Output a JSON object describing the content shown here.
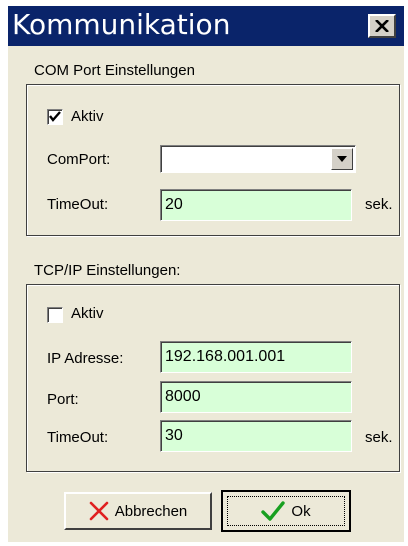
{
  "window": {
    "title": "Kommunikation"
  },
  "com": {
    "group_title": "COM Port Einstellungen",
    "aktiv_label": "Aktiv",
    "aktiv_checked": true,
    "comport_label": "ComPort:",
    "comport_value": "",
    "timeout_label": "TimeOut:",
    "timeout_value": "20",
    "timeout_unit": "sek."
  },
  "tcp": {
    "group_title": "TCP/IP Einstellungen:",
    "aktiv_label": "Aktiv",
    "aktiv_checked": false,
    "ip_label": "IP Adresse:",
    "ip_value": "192.168.001.001",
    "port_label": "Port:",
    "port_value": "8000",
    "timeout_label": "TimeOut:",
    "timeout_value": "30",
    "timeout_unit": "sek."
  },
  "buttons": {
    "cancel_label": "Abbrechen",
    "ok_label": "Ok"
  },
  "colors": {
    "titlebar": "#0a246a",
    "field_bg": "#d8ffd8",
    "window_bg": "#ece9d8",
    "cancel_icon": "#e02020",
    "ok_icon": "#18a020"
  },
  "icons": {
    "close": "close-icon",
    "check": "checkmark-icon",
    "dropdown": "chevron-down-icon",
    "cancel": "red-x-icon",
    "ok": "green-check-icon"
  }
}
